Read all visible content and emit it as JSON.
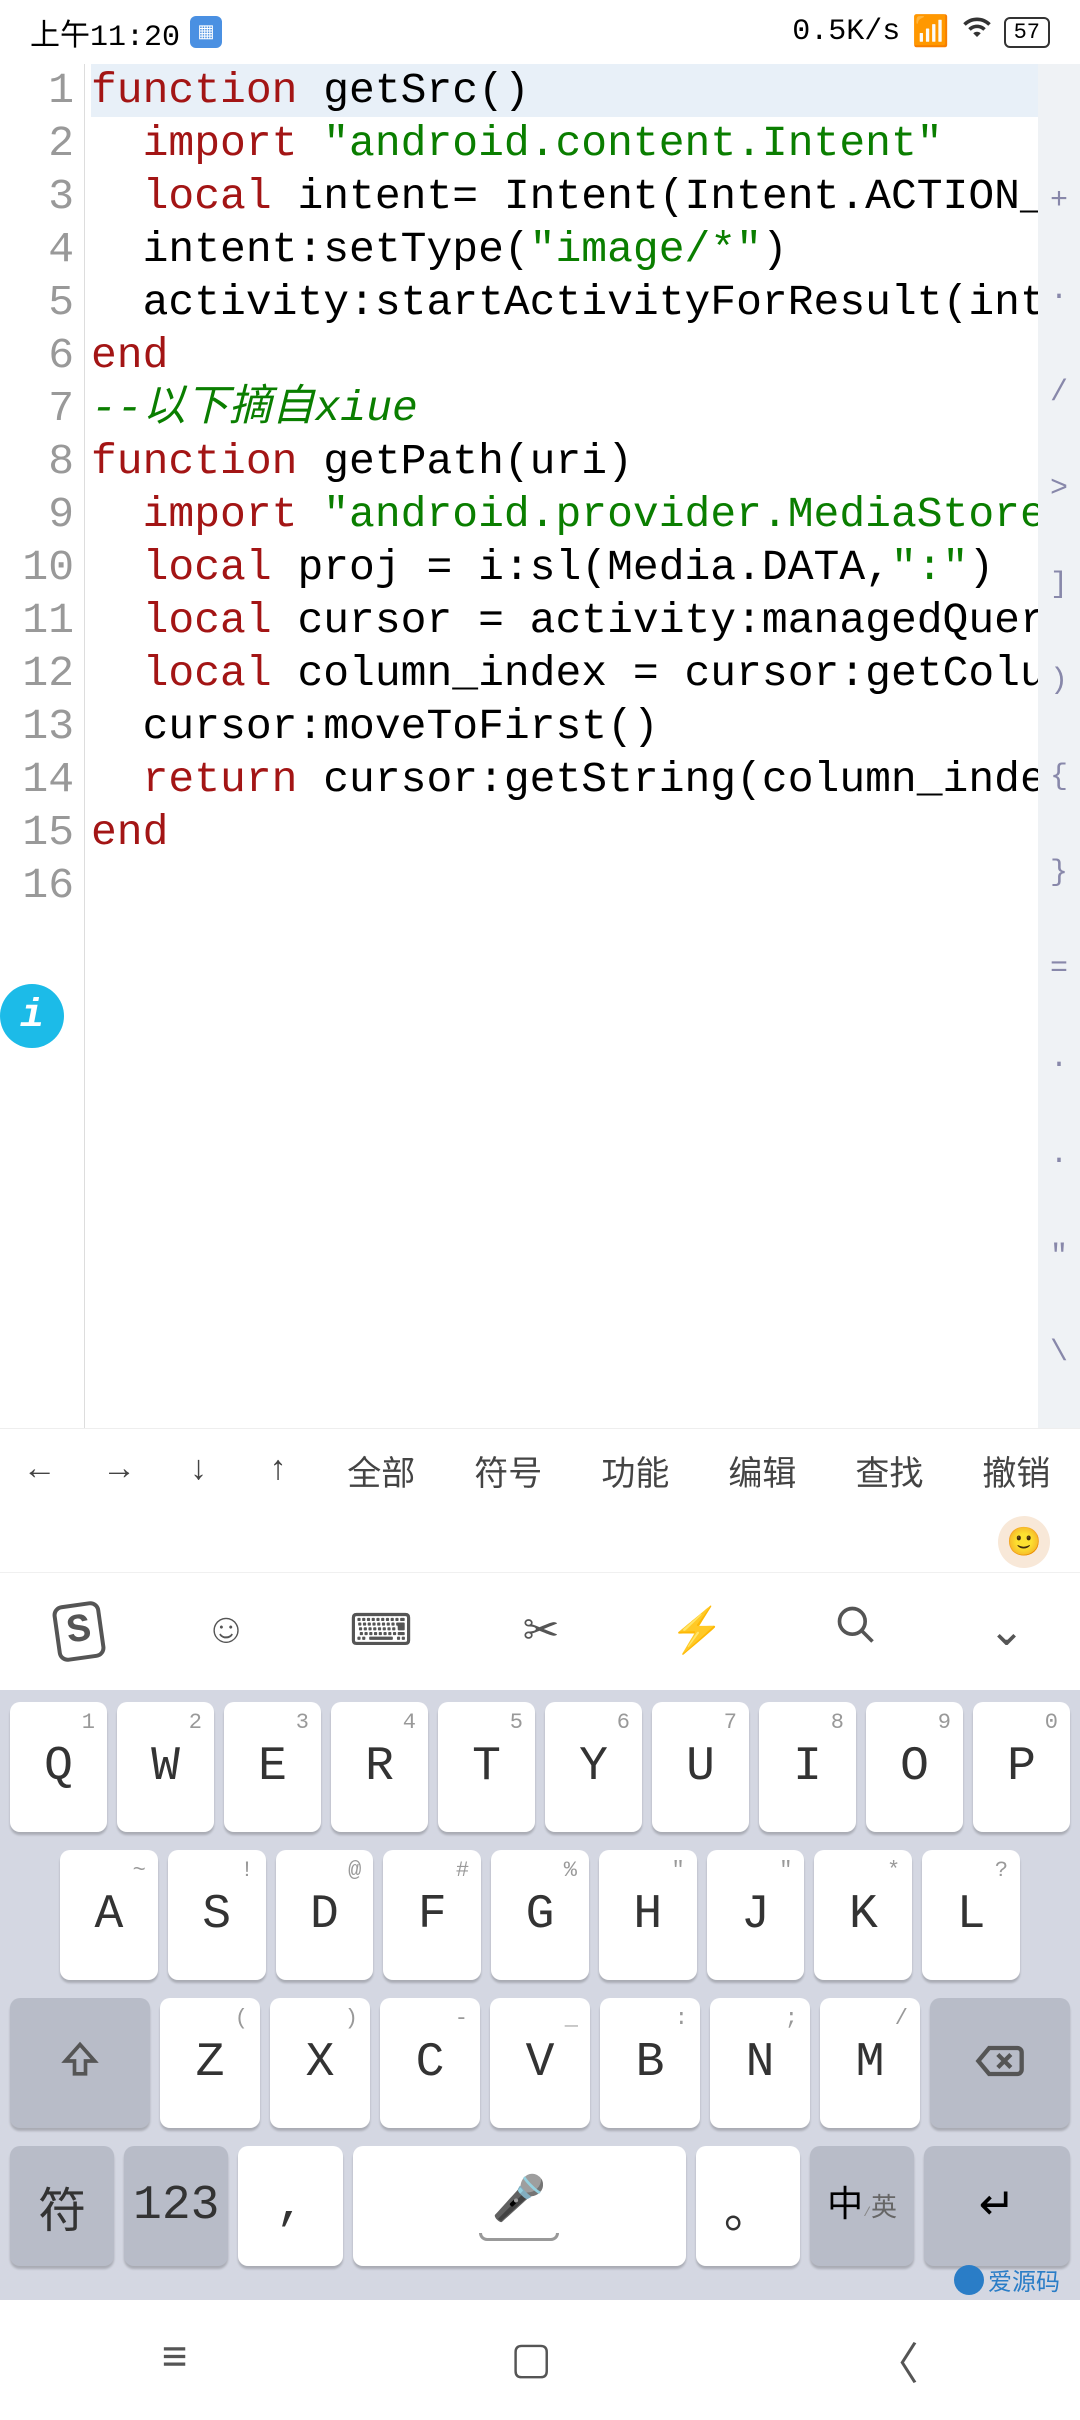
{
  "status": {
    "time": "上午11:20",
    "speed": "0.5K/s",
    "battery": "57"
  },
  "code": {
    "lines": [
      {
        "n": 1,
        "tokens": [
          [
            "kw",
            "function"
          ],
          [
            "fn",
            " getSrc()"
          ]
        ]
      },
      {
        "n": 2,
        "tokens": [
          [
            "",
            "  "
          ],
          [
            "kw",
            "import"
          ],
          [
            "",
            " "
          ],
          [
            "str",
            "\"android.content.Intent\""
          ]
        ]
      },
      {
        "n": 3,
        "tokens": [
          [
            "",
            "  "
          ],
          [
            "kw",
            "local"
          ],
          [
            "",
            " intent= Intent(Intent.ACTION_P"
          ]
        ]
      },
      {
        "n": 4,
        "tokens": [
          [
            "",
            "  intent:setType("
          ],
          [
            "str",
            "\"image/*\""
          ],
          [
            "",
            ")"
          ]
        ]
      },
      {
        "n": 5,
        "tokens": [
          [
            "",
            "  activity:startActivityForResult(inte"
          ]
        ]
      },
      {
        "n": 6,
        "tokens": [
          [
            "kw",
            "end"
          ]
        ]
      },
      {
        "n": 7,
        "tokens": [
          [
            "",
            ""
          ]
        ]
      },
      {
        "n": 8,
        "tokens": [
          [
            "cmt",
            "--以下摘自xiue"
          ]
        ]
      },
      {
        "n": 9,
        "tokens": [
          [
            "kw",
            "function"
          ],
          [
            "fn",
            " getPath(uri)"
          ]
        ]
      },
      {
        "n": 10,
        "tokens": [
          [
            "",
            "  "
          ],
          [
            "kw",
            "import"
          ],
          [
            "",
            " "
          ],
          [
            "str",
            "\"android.provider.MediaStore$"
          ]
        ]
      },
      {
        "n": 11,
        "tokens": [
          [
            "",
            "  "
          ],
          [
            "kw",
            "local"
          ],
          [
            "",
            " proj = i:sl(Media.DATA,"
          ],
          [
            "str",
            "\":\""
          ],
          [
            "",
            ")"
          ]
        ]
      },
      {
        "n": 12,
        "tokens": [
          [
            "",
            "  "
          ],
          [
            "kw",
            "local"
          ],
          [
            "",
            " cursor = activity:managedQuery"
          ]
        ]
      },
      {
        "n": 13,
        "tokens": [
          [
            "",
            "  "
          ],
          [
            "kw",
            "local"
          ],
          [
            "",
            " column_index = cursor:getColum"
          ]
        ]
      },
      {
        "n": 14,
        "tokens": [
          [
            "",
            "  "
          ],
          [
            "fn",
            "cursor:moveToFirst()"
          ]
        ]
      },
      {
        "n": 15,
        "tokens": [
          [
            "",
            "  "
          ],
          [
            "kw",
            "return"
          ],
          [
            "",
            " cursor:getString(column_index"
          ]
        ]
      },
      {
        "n": 16,
        "tokens": [
          [
            "kw",
            "end"
          ]
        ]
      }
    ]
  },
  "right_strip": [
    "+",
    "·",
    "/",
    ">",
    "]",
    ")",
    "{",
    "}",
    "=",
    "·",
    "·",
    "\"",
    "\\"
  ],
  "toolbar": [
    "←",
    "→",
    "↓",
    "↑",
    "全部",
    "符号",
    "功能",
    "编辑",
    "查找",
    "撤销"
  ],
  "keyboard": {
    "row1": [
      {
        "s": "1",
        "m": "Q"
      },
      {
        "s": "2",
        "m": "W"
      },
      {
        "s": "3",
        "m": "E"
      },
      {
        "s": "4",
        "m": "R"
      },
      {
        "s": "5",
        "m": "T"
      },
      {
        "s": "6",
        "m": "Y"
      },
      {
        "s": "7",
        "m": "U"
      },
      {
        "s": "8",
        "m": "I"
      },
      {
        "s": "9",
        "m": "O"
      },
      {
        "s": "0",
        "m": "P"
      }
    ],
    "row2": [
      {
        "s": "~",
        "m": "A"
      },
      {
        "s": "!",
        "m": "S"
      },
      {
        "s": "@",
        "m": "D"
      },
      {
        "s": "#",
        "m": "F"
      },
      {
        "s": "%",
        "m": "G"
      },
      {
        "s": "\"",
        "m": "H"
      },
      {
        "s": "\"",
        "m": "J"
      },
      {
        "s": "*",
        "m": "K"
      },
      {
        "s": "?",
        "m": "L"
      }
    ],
    "row3": [
      {
        "s": "(",
        "m": "Z"
      },
      {
        "s": ")",
        "m": "X"
      },
      {
        "s": "-",
        "m": "C"
      },
      {
        "s": "_",
        "m": "V"
      },
      {
        "s": ":",
        "m": "B"
      },
      {
        "s": ";",
        "m": "N"
      },
      {
        "s": "/",
        "m": "M"
      }
    ],
    "bottom": {
      "sym": "符",
      "num": "123",
      "comma": ",",
      "period": "。",
      "ime": "中",
      "ime2": "英"
    }
  },
  "watermark": "爱源码"
}
